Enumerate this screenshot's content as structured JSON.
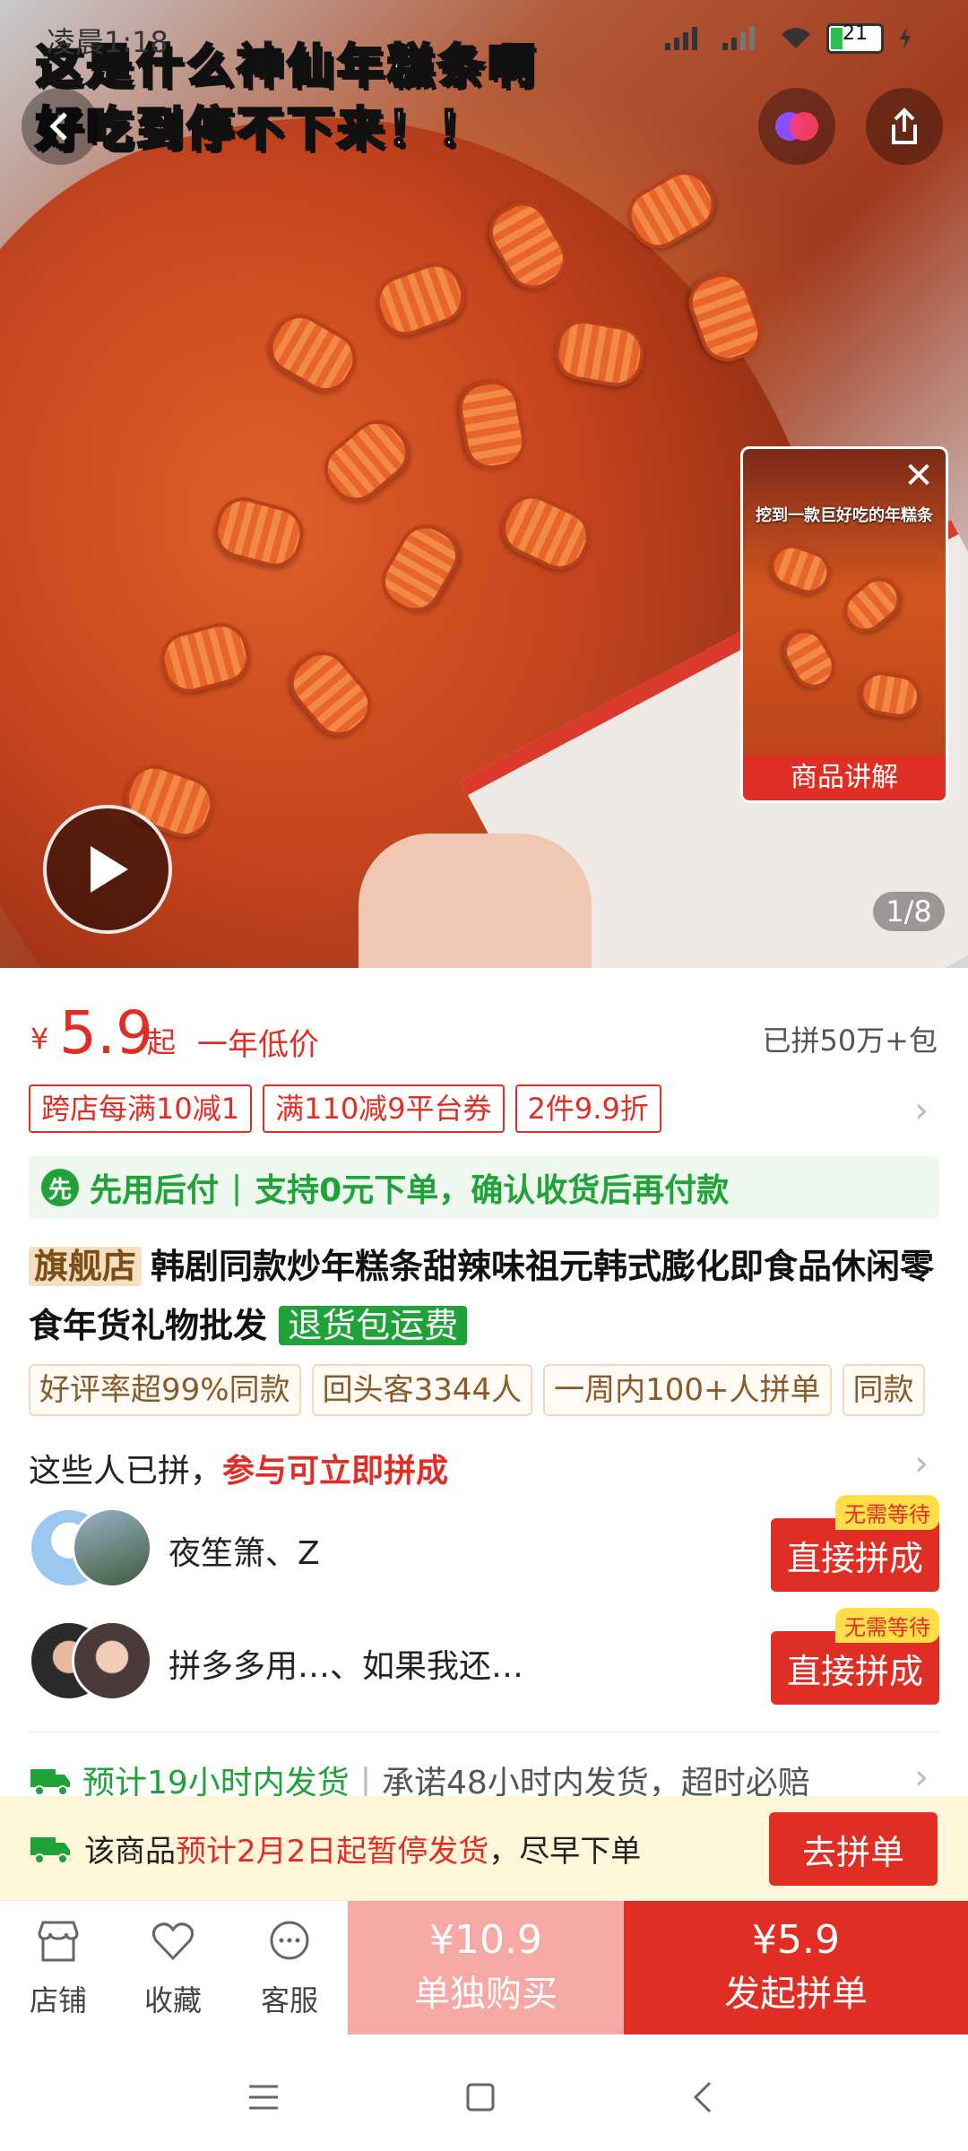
{
  "status_bar": {
    "time": "凌晨1:18",
    "battery": "21"
  },
  "hero": {
    "banner_line1": "这是什么神仙年糕条啊",
    "banner_line2": "好吃到停不下来！！",
    "counter": "1/8",
    "mini_video": {
      "caption": "挖到一款巨好吃的年糕条",
      "label": "商品讲解"
    }
  },
  "price": {
    "symbol": "¥",
    "value": "5.9",
    "suffix": "起",
    "note": "一年低价",
    "sold": "已拼50万+包"
  },
  "coupons": [
    "跨店每满10减1",
    "满110减9平台券",
    "2件9.9折"
  ],
  "pay_later": {
    "title": "先用后付",
    "desc": "支持0元下单，确认收货后再付款"
  },
  "product": {
    "store_badge": "旗舰店",
    "title": "韩剧同款炒年糕条甜辣味祖元韩式膨化即食品休闲零食年货礼物批发",
    "return_badge": "退货包运费"
  },
  "tags": [
    "好评率超99%同款",
    "回头客3344人",
    "一周内100+人拼单",
    "同款"
  ],
  "group": {
    "heading_plain": "这些人已拼，",
    "heading_red": "参与可立即拼成",
    "rows": [
      {
        "names": "夜笙箫、Z",
        "button": "直接拼成",
        "badge": "无需等待"
      },
      {
        "names": "拼多多用…、如果我还…",
        "button": "直接拼成",
        "badge": "无需等待"
      }
    ]
  },
  "shipping": {
    "estimate": "预计19小时内发货",
    "promise": "承诺48小时内发货，超时必赔"
  },
  "pause_notice": {
    "prefix": "该商品",
    "highlight": "预计2月2日起暂停发货",
    "suffix": "，尽早下单",
    "button": "去拼单"
  },
  "actions": {
    "shop": "店铺",
    "favorite": "收藏",
    "service": "客服",
    "buy_alone_price": "¥10.9",
    "buy_alone_label": "单独购买",
    "buy_group_price": "¥5.9",
    "buy_group_label": "发起拼单"
  },
  "colors": {
    "accent": "#e02e24",
    "green": "#1fa339"
  }
}
